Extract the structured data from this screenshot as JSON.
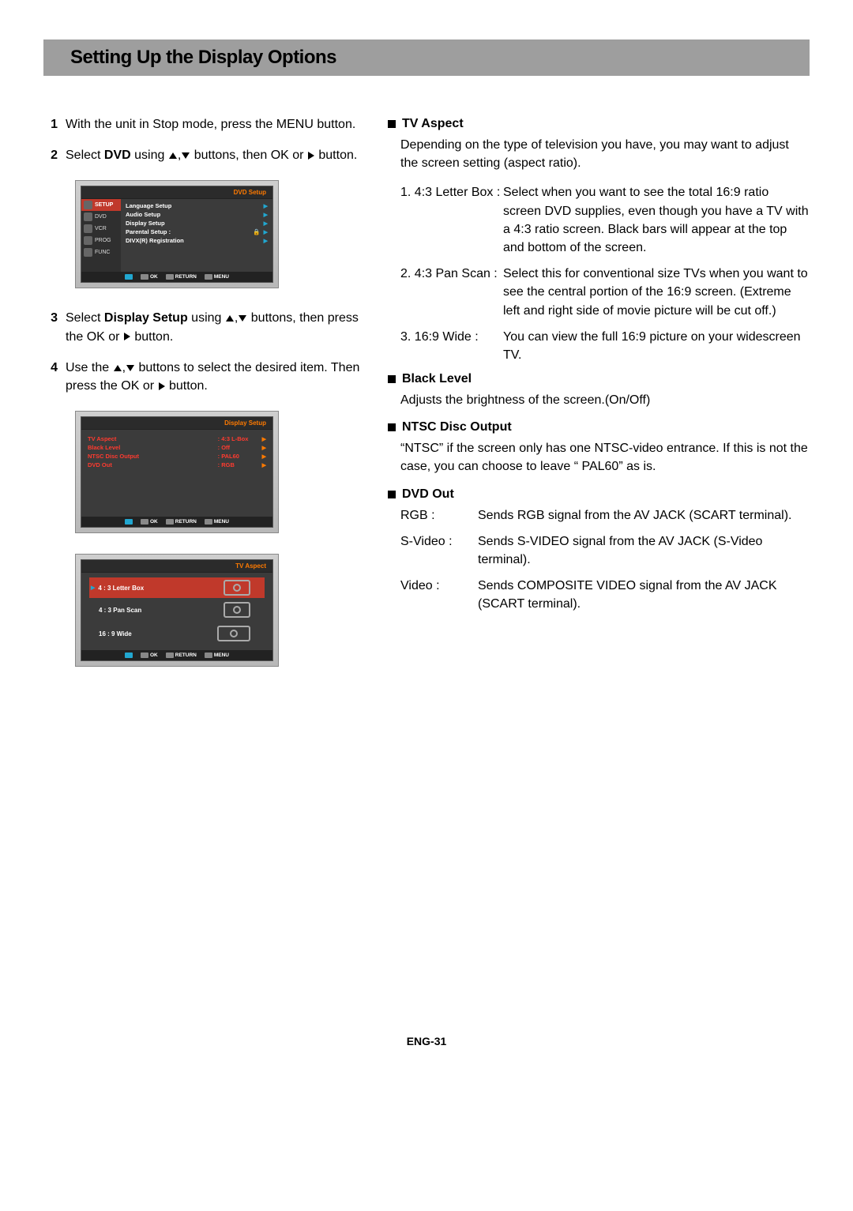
{
  "page_title": "Setting Up the Display Options",
  "page_number": "ENG-31",
  "steps": {
    "s1": "With the unit in Stop mode, press the MENU button.",
    "s2a": "Select ",
    "s2b": "DVD",
    "s2c": " using ",
    "s2d": " buttons, then OK or ",
    "s2e": " button.",
    "s3a": "Select ",
    "s3b": "Display Setup",
    "s3c": " using ",
    "s3d": " buttons, then press the OK or ",
    "s3e": " button.",
    "s4a": "Use the ",
    "s4b": " buttons to select the desired item. Then press the OK or ",
    "s4c": " button."
  },
  "osd1": {
    "title": "DVD Setup",
    "side": [
      "SETUP",
      "DVD",
      "VCR",
      "PROG",
      "FUNC"
    ],
    "rows": [
      "Language Setup",
      "Audio Setup",
      "Display Setup",
      "Parental Setup      :",
      "DIVX(R) Registration"
    ],
    "foot_ok": "OK",
    "foot_return": "RETURN",
    "foot_menu": "MENU"
  },
  "osd2": {
    "title": "Display Setup",
    "rows": [
      {
        "lbl": "TV Aspect",
        "val": ":  4:3 L-Box"
      },
      {
        "lbl": "Black Level",
        "val": ":  Off"
      },
      {
        "lbl": "NTSC Disc Output",
        "val": ":  PAL60"
      },
      {
        "lbl": "DVD Out",
        "val": ":  RGB"
      }
    ],
    "foot_ok": "OK",
    "foot_return": "RETURN",
    "foot_menu": "MENU"
  },
  "osd3": {
    "title": "TV Aspect",
    "rows": [
      "4 : 3  Letter Box",
      "4 : 3 Pan Scan",
      "16 : 9 Wide"
    ],
    "foot_ok": "OK",
    "foot_return": "RETURN",
    "foot_menu": "MENU"
  },
  "right": {
    "tv_aspect_title": "TV Aspect",
    "tv_aspect_intro": "Depending on the type of television you have, you may want to adjust the screen setting (aspect ratio).",
    "tv1_term": "1. 4:3 Letter Box :",
    "tv1_desc": "Select when you want to see the total 16:9 ratio screen DVD supplies, even though you have a TV with a 4:3 ratio screen. Black bars will appear at the top and bottom of the screen.",
    "tv2_term": "2. 4:3 Pan Scan :",
    "tv2_desc": "Select this for conventional size TVs when you want to see the central portion of the 16:9 screen. (Extreme left and right side of movie picture will be cut off.)",
    "tv3_term": "3. 16:9 Wide :",
    "tv3_desc": "You can view the full 16:9 picture on your widescreen TV.",
    "black_title": "Black Level",
    "black_desc": "Adjusts the brightness of the screen.(On/Off)",
    "ntsc_title": "NTSC Disc Output",
    "ntsc_desc": "“NTSC” if the screen only has one NTSC-video entrance. If this is not the case, you can choose to leave “ PAL60” as is.",
    "dvdout_title": "DVD Out",
    "rgb_term": "RGB :",
    "rgb_desc": "Sends RGB signal from the AV JACK (SCART terminal).",
    "sv_term": "S-Video :",
    "sv_desc": "Sends S-VIDEO signal from the AV JACK (S-Video terminal).",
    "vid_term": "Video :",
    "vid_desc": "Sends COMPOSITE VIDEO signal from the AV JACK (SCART terminal)."
  }
}
